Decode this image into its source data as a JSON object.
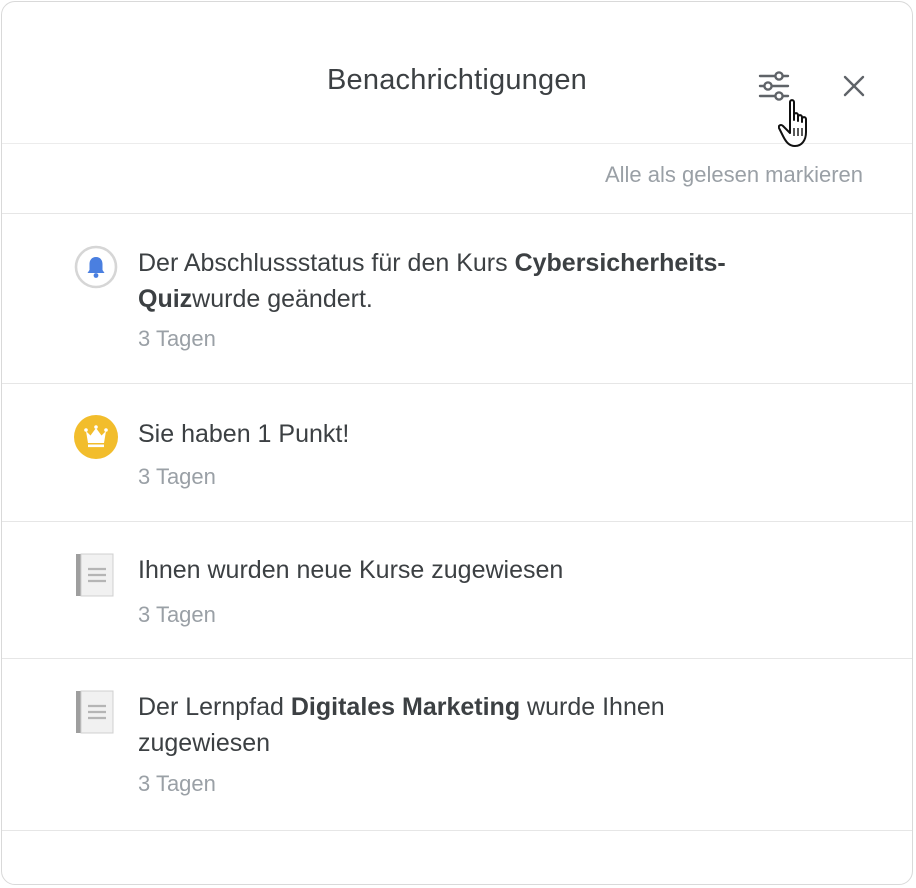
{
  "header": {
    "title": "Benachrichtigungen",
    "settings_icon": "sliders-icon",
    "close_icon": "close-icon"
  },
  "actions": {
    "mark_all_read": "Alle als gelesen markieren"
  },
  "notifications": [
    {
      "icon": "bell-icon",
      "text_before": "Der Abschlussstatus für den Kurs ",
      "text_bold": "Cybersicherheits-Quiz",
      "text_after": "wurde geändert.",
      "time": "3 Tagen"
    },
    {
      "icon": "crown-icon",
      "text_before": "Sie haben 1 Punkt!",
      "text_bold": "",
      "text_after": "",
      "time": "3 Tagen"
    },
    {
      "icon": "document-icon",
      "text_before": "Ihnen wurden neue Kurse zugewiesen",
      "text_bold": "",
      "text_after": "",
      "time": "3 Tagen"
    },
    {
      "icon": "document-icon",
      "text_before": "Der Lernpfad ",
      "text_bold": "Digitales Marketing",
      "text_after": " wurde Ihnen zugewiesen",
      "time": "3 Tagen"
    }
  ],
  "colors": {
    "bell": "#4a7fe0",
    "crown": "#f2bd2c",
    "muted_text": "#9aa0a6",
    "main_text": "#3c4043"
  }
}
